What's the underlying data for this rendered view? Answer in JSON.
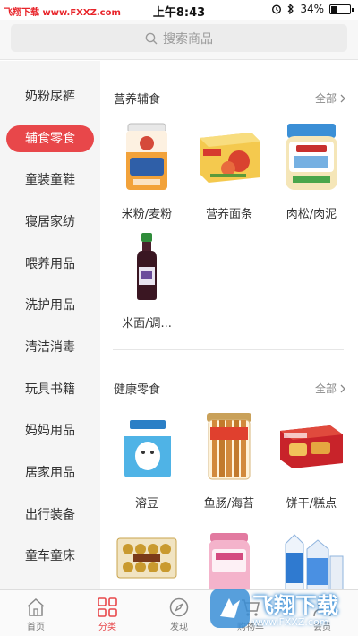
{
  "status_bar": {
    "watermark": "飞翔下载 www.FXXZ.com",
    "time": "上午8:43",
    "battery_percent": "34%",
    "battery_level": 0.34
  },
  "search": {
    "placeholder": "搜索商品"
  },
  "sidebar": {
    "items": [
      {
        "label": "奶粉尿裤",
        "active": false
      },
      {
        "label": "辅食零食",
        "active": true
      },
      {
        "label": "童装童鞋",
        "active": false
      },
      {
        "label": "寝居家纺",
        "active": false
      },
      {
        "label": "喂养用品",
        "active": false
      },
      {
        "label": "洗护用品",
        "active": false
      },
      {
        "label": "清洁消毒",
        "active": false
      },
      {
        "label": "玩具书籍",
        "active": false
      },
      {
        "label": "妈妈用品",
        "active": false
      },
      {
        "label": "居家用品",
        "active": false
      },
      {
        "label": "出行装备",
        "active": false
      },
      {
        "label": "童车童床",
        "active": false
      }
    ]
  },
  "sections": [
    {
      "title": "营养辅食",
      "more": "全部",
      "products": [
        {
          "label": "米粉/麦粉",
          "icon": "cereal-can-icon"
        },
        {
          "label": "营养面条",
          "icon": "noodle-box-icon"
        },
        {
          "label": "肉松/肉泥",
          "icon": "puree-jar-icon"
        },
        {
          "label": "米面/调...",
          "icon": "sauce-bottle-icon"
        }
      ]
    },
    {
      "title": "健康零食",
      "more": "全部",
      "products": [
        {
          "label": "溶豆",
          "icon": "melt-box-icon"
        },
        {
          "label": "鱼肠/海苔",
          "icon": "sausage-jar-icon"
        },
        {
          "label": "饼干/糕点",
          "icon": "biscuit-box-icon"
        },
        {
          "label": "",
          "icon": "chocolate-box-icon"
        },
        {
          "label": "",
          "icon": "candy-jar-icon"
        },
        {
          "label": "",
          "icon": "milk-carton-icon"
        }
      ]
    }
  ],
  "tabbar": {
    "items": [
      {
        "label": "首页",
        "icon": "home-icon",
        "active": false
      },
      {
        "label": "分类",
        "icon": "category-icon",
        "active": true
      },
      {
        "label": "发现",
        "icon": "compass-icon",
        "active": false
      },
      {
        "label": "购物车",
        "icon": "cart-icon",
        "active": false
      },
      {
        "label": "会员",
        "icon": "user-icon",
        "active": false
      }
    ]
  },
  "watermark": {
    "brand": "飞翔下载",
    "url": "www.FXXZ.com"
  },
  "colors": {
    "accent": "#e8474a",
    "watermark_red": "#e8242a",
    "watermark_blue": "#3a8ed6"
  }
}
